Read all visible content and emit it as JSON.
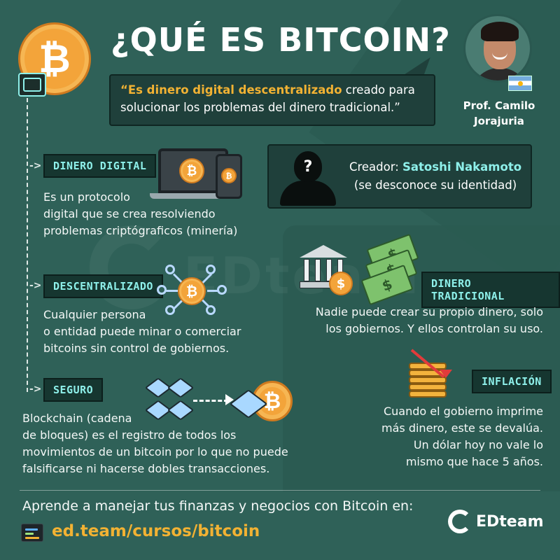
{
  "title": "¿QUÉ ES BITCOIN?",
  "quote": {
    "highlight": "“Es dinero digital descentralizado",
    "rest": " creado para solucionar los problemas del dinero tradicional.”"
  },
  "profile": {
    "line1": "Prof. Camilo",
    "line2": "Jorajuria"
  },
  "watermark": "EDteam",
  "sections": {
    "digital": {
      "label": "DINERO DIGITAL",
      "line1": "Es un protocolo",
      "line2": "digital que se crea resolviendo",
      "line3": "problemas criptógraficos (minería)"
    },
    "creator": {
      "prefix": "Creador: ",
      "name": "Satoshi Nakamoto",
      "note": "(se desconoce su identidad)",
      "unknown_mark": "?"
    },
    "decentralized": {
      "label": "DESCENTRALIZADO",
      "line1": "Cualquier persona",
      "line2": "o entidad puede minar o comerciar",
      "line3": "bitcoins sin control de gobiernos."
    },
    "traditional": {
      "label": "DINERO TRADICIONAL",
      "line1": "Nadie puede crear su propio dinero, solo",
      "line2": "los gobiernos. Y ellos controlan su uso."
    },
    "secure": {
      "label": "SEGURO",
      "line1": "Blockchain (cadena",
      "line2": "de bloques) es el registro de todos los",
      "line3": "movimientos de un bitcoin por lo que no puede",
      "line4": "falsificarse ni hacerse dobles transacciones."
    },
    "inflation": {
      "label": "INFLACIÓN",
      "line1": "Cuando el gobierno imprime",
      "line2": "más dinero, este se devalúa.",
      "line3": "Un dólar hoy no vale lo",
      "line4": "mismo que hace 5 años."
    }
  },
  "symbols": {
    "bitcoin": "₿",
    "dollar": "$",
    "arrow": "->"
  },
  "footer": {
    "text": "Aprende a manejar tus finanzas y negocios con Bitcoin en:",
    "link": "ed.team/cursos/bitcoin",
    "brand": "EDteam"
  },
  "colors": {
    "background": "#2f6158",
    "accent_yellow": "#f2b233",
    "accent_cyan": "#8ef0ea",
    "box_dark": "#1f403b"
  }
}
